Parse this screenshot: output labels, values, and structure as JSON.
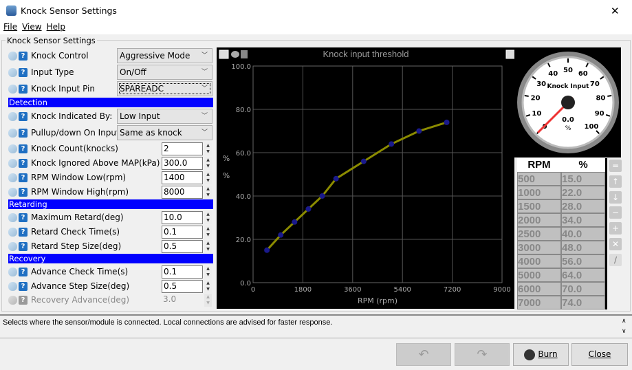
{
  "window": {
    "title": "Knock Sensor Settings",
    "close": "✕"
  },
  "menu": [
    "File",
    "View",
    "Help"
  ],
  "group_title": "Knock Sensor Settings",
  "fields": {
    "knock_control": {
      "label": "Knock Control",
      "value": "Aggressive Mode"
    },
    "input_type": {
      "label": "Input Type",
      "value": "On/Off"
    },
    "knock_input_pin": {
      "label": "Knock Input Pin",
      "value": "SPAREADC"
    },
    "detection": "Detection",
    "knock_indicated": {
      "label": "Knock Indicated By:",
      "value": "Low Input"
    },
    "pullup": {
      "label": "Pullup/down On Input",
      "value": "Same as knock"
    },
    "knock_count": {
      "label": "Knock Count(knocks)",
      "value": "2"
    },
    "ignored_map": {
      "label": "Knock Ignored Above MAP(kPa)",
      "value": "300.0"
    },
    "rpm_low": {
      "label": "RPM Window Low(rpm)",
      "value": "1400"
    },
    "rpm_high": {
      "label": "RPM Window High(rpm)",
      "value": "8000"
    },
    "retarding": "Retarding",
    "max_retard": {
      "label": "Maximum Retard(deg)",
      "value": "10.0"
    },
    "retard_check": {
      "label": "Retard Check Time(s)",
      "value": "0.1"
    },
    "retard_step": {
      "label": "Retard Step Size(deg)",
      "value": "0.5"
    },
    "recovery": "Recovery",
    "advance_check": {
      "label": "Advance Check Time(s)",
      "value": "0.1"
    },
    "advance_step": {
      "label": "Advance Step Size(deg)",
      "value": "0.5"
    },
    "recovery_advance": {
      "label": "Recovery Advance(deg)",
      "value": "3.0"
    }
  },
  "chart_data": {
    "type": "line",
    "title": "Knock input threshold",
    "xlabel": "RPM (rpm)",
    "ylabel": "%",
    "xlim": [
      0,
      9000
    ],
    "ylim": [
      0,
      100
    ],
    "xticks": [
      "0",
      "1800",
      "3600",
      "5400",
      "7200",
      "9000"
    ],
    "yticks": [
      "0.0",
      "20.0",
      "40.0",
      "60.0",
      "80.0",
      "100.0"
    ],
    "x": [
      500,
      1000,
      1500,
      2000,
      2500,
      3000,
      4000,
      5000,
      6000,
      7000
    ],
    "y": [
      15,
      22,
      28,
      34,
      40,
      48,
      56,
      64,
      70,
      74
    ],
    "line_color": "#8b8b00",
    "point_color": "#1a1a8c",
    "button": "..."
  },
  "gauge": {
    "title": "Knock Input",
    "value": "0.0",
    "units": "%",
    "value_num": 0,
    "ticks": [
      "0",
      "10",
      "20",
      "30",
      "40",
      "50",
      "60",
      "70",
      "80",
      "90",
      "100"
    ]
  },
  "table": {
    "headers": [
      "RPM",
      "%"
    ]
  },
  "status": "Selects where the sensor/module is connected. Local connections are advised for faster response.",
  "buttons": {
    "burn": "Burn",
    "close": "Close"
  }
}
